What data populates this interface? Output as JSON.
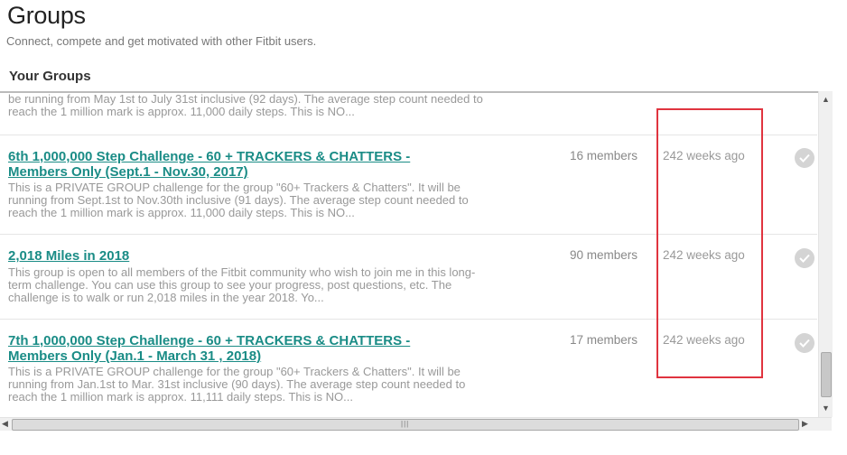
{
  "header": {
    "title": "Groups",
    "subtitle": "Connect, compete and get motivated with other Fitbit users."
  },
  "section": {
    "title": "Your Groups"
  },
  "groups": [
    {
      "title": "",
      "description": "be running from May 1st to July 31st inclusive (92 days). The average step count needed to reach the 1 million mark is approx. 11,000 daily steps. This is NO...",
      "members": "",
      "time": ""
    },
    {
      "title": "6th 1,000,000 Step Challenge - 60 + TRACKERS & CHATTERS - Members Only (Sept.1 - Nov.30, 2017)",
      "description": "This is a PRIVATE GROUP challenge for the group \"60+ Trackers & Chatters\". It will be running from Sept.1st to Nov.30th inclusive (91 days). The average step count needed to reach the 1 million mark is approx. 11,000 daily steps. This is NO...",
      "members": "16 members",
      "time": "242 weeks ago"
    },
    {
      "title": "2,018 Miles in 2018",
      "description": "This group is open to all members of the Fitbit community who wish to join me in this long-term challenge. You can use this group to see your progress, post questions, etc. The challenge is to walk or run 2,018 miles in the year 2018. Yo...",
      "members": "90 members",
      "time": "242 weeks ago"
    },
    {
      "title": "7th 1,000,000 Step Challenge - 60 + TRACKERS & CHATTERS - Members Only (Jan.1 - March 31 , 2018)",
      "description": "This is a PRIVATE GROUP challenge for the group \"60+ Trackers & Chatters\". It will be running from Jan.1st to Mar. 31st inclusive (90 days). The average step count needed to reach the 1 million mark is approx. 11,111 daily steps. This is NO...",
      "members": "17 members",
      "time": "242 weeks ago"
    }
  ],
  "icons": {
    "joined": "check-circle-icon",
    "scroll_up": "arrow-up-icon",
    "scroll_down": "arrow-down-icon",
    "scroll_left": "arrow-left-icon",
    "scroll_right": "arrow-right-icon"
  },
  "colors": {
    "link": "#1a8c86",
    "annotation": "#e0343f"
  }
}
